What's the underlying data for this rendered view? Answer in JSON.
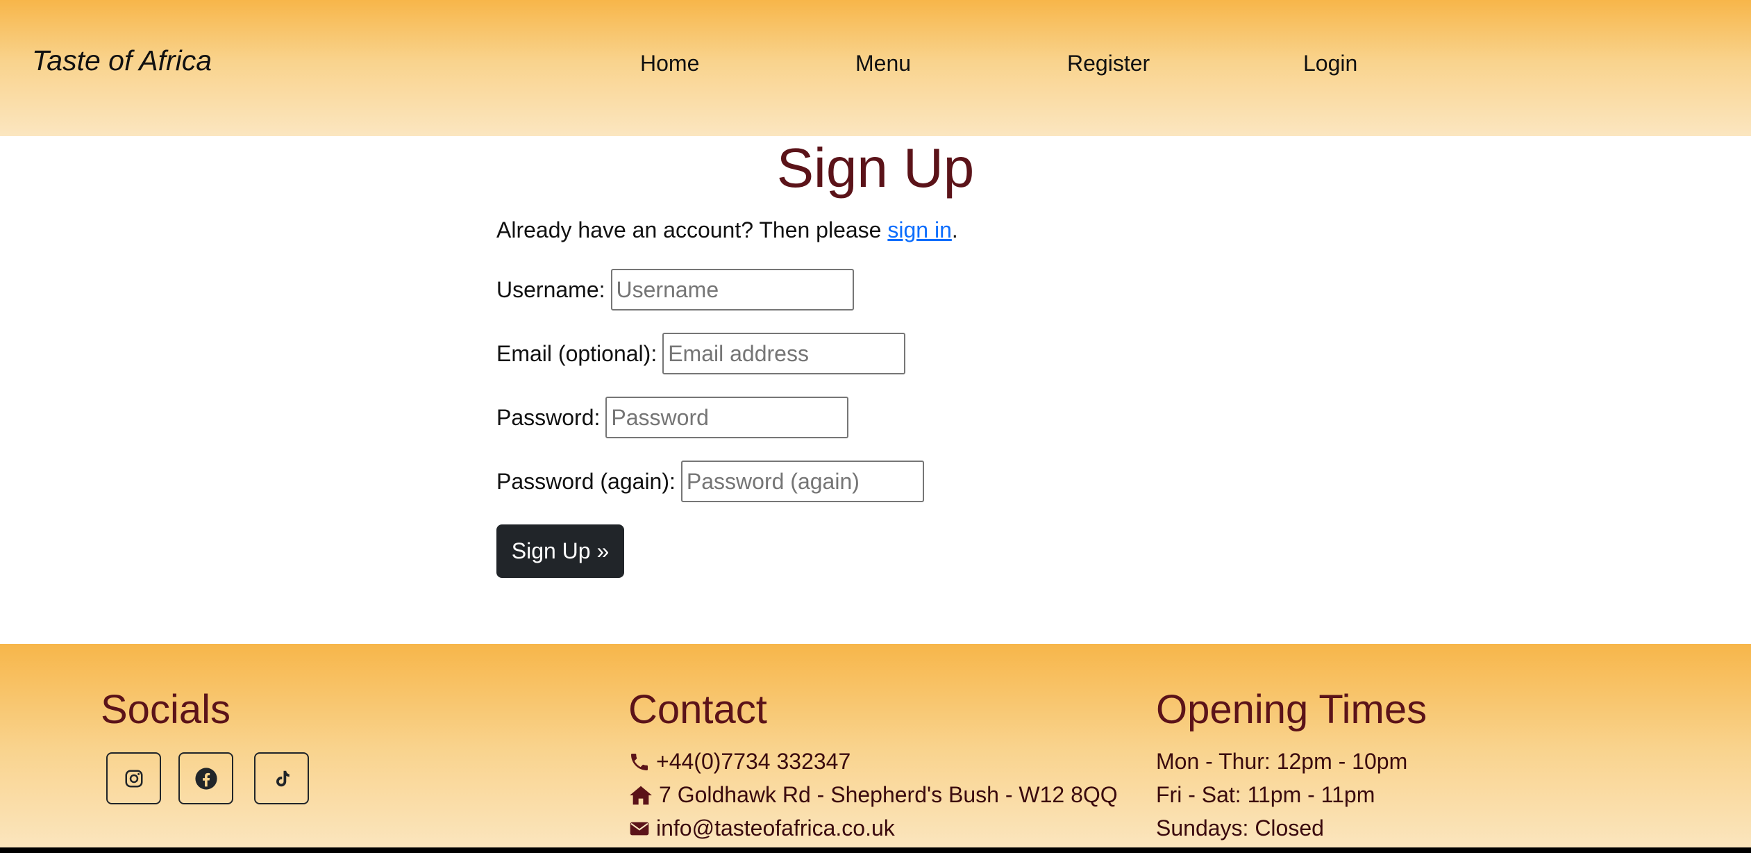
{
  "header": {
    "brand": "Taste of Africa",
    "nav": {
      "home": "Home",
      "menu": "Menu",
      "register": "Register",
      "login": "Login"
    }
  },
  "main": {
    "title": "Sign Up",
    "intro_text": "Already have an account? Then please ",
    "intro_link": "sign in",
    "intro_end": ".",
    "fields": {
      "username": {
        "label": "Username:",
        "placeholder": "Username",
        "value": ""
      },
      "email": {
        "label": "Email (optional):",
        "placeholder": "Email address",
        "value": ""
      },
      "password": {
        "label": "Password:",
        "placeholder": "Password",
        "value": ""
      },
      "password2": {
        "label": "Password (again):",
        "placeholder": "Password (again)",
        "value": ""
      }
    },
    "submit_label": "Sign Up »"
  },
  "footer": {
    "socials_heading": "Socials",
    "socials": [
      "instagram-icon",
      "facebook-icon",
      "tiktok-icon"
    ],
    "contact_heading": "Contact",
    "contact": {
      "phone": "+44(0)7734 332347",
      "address": "7 Goldhawk Rd - Shepherd's Bush - W12 8QQ",
      "email": "info@tasteofafrica.co.uk"
    },
    "hours_heading": "Opening Times",
    "hours": [
      "Mon - Thur: 12pm - 10pm",
      "Fri - Sat: 11pm - 11pm",
      "Sundays: Closed"
    ]
  },
  "colors": {
    "header_gradient_top": "#f7b64a",
    "header_gradient_bottom": "#fbe6c0",
    "heading_maroon": "#5b1319",
    "link_blue": "#0d6efd",
    "button_dark": "#212529"
  }
}
